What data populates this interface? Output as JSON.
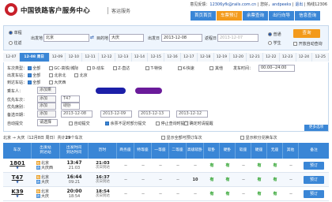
{
  "header": {
    "site_name": "中国铁路客户服务中心",
    "sub_name": "客运服务",
    "user_prefix": "意见反馈：",
    "email": "12306yfk@rails.com.cn",
    "sep1": "|",
    "welcome": "您好，",
    "username": "andpeeks",
    "sep2": "|",
    "logout": "退出",
    "sep3": "|",
    "phone": "热线12306"
  },
  "nav": [
    "首页首页",
    "车票预订",
    "余票查询",
    "出行向导",
    "信息查询"
  ],
  "search": {
    "oneway_label": "单程",
    "roundtrip_label": "往返",
    "from_label": "出发地",
    "from_value": "北京",
    "to_label": "目的地",
    "to_value": "大庆",
    "date_label": "出发日",
    "date_value": "2013-12-08",
    "return_label": "返程日",
    "return_value": "2013-12-07",
    "adult_label": "普通",
    "student_label": "学生",
    "query_button": "查询",
    "sort_label": "开放自动查询"
  },
  "dates": [
    "12-07",
    "12-08 周日",
    "12-09",
    "12-10",
    "12-11",
    "12-12",
    "12-13",
    "12-14",
    "12-15",
    "12-16",
    "12-17",
    "12-18",
    "12-19",
    "12-20",
    "12-21",
    "12-22",
    "12-23",
    "12-24",
    "12-25",
    "12-26"
  ],
  "filter": {
    "type_label": "车次类型：",
    "types": [
      "全部",
      "GC-高铁/城际",
      "D-动车",
      "Z-直达",
      "T-特快",
      "K-快速",
      "其他"
    ],
    "dep_label": "出发车站：",
    "dep_stations": [
      "全部",
      "北京北",
      "北京"
    ],
    "arr_label": "到达车站：",
    "arr_stations": [
      "全部",
      "大庆西"
    ],
    "time_label": "发车时间：",
    "time_value": "00:00--24:00",
    "passenger_label": "乘车人：",
    "passenger_add": "添加乘",
    "seat_label": "优先车次：",
    "seat_add": "添加",
    "train_tag": "T47",
    "seat_type_label": "优先席别：",
    "seat_type_add": "添加",
    "seat_type_value": "硬卧",
    "date_pref_label": "备选日期：",
    "date_pref_add": "添加",
    "pref_dates": [
      "2013-12-08",
      "2013-12-09",
      "2013-12-13",
      "2013-12-12"
    ],
    "submit_label": "自动提交",
    "submit_value": "请选择",
    "option1": "自动提交",
    "option2": "余票不足时部分提交",
    "option3": "停止查询时提醒",
    "option4": "确定时请提醒",
    "more": "更多选项"
  },
  "result": {
    "route": "北京 → 大庆（12月8日 周日）共计",
    "count": "29",
    "suffix": "个车次",
    "filter_note": "显示全部可预订车次",
    "sort_note": "显示积分兑换车次"
  },
  "table_header": [
    "车次",
    "出发站\n到达站",
    "出发时间\n到达时间",
    "历时",
    "商务座",
    "特等座",
    "一等座",
    "二等座",
    "高级软卧",
    "软卧",
    "硬卧",
    "软座",
    "硬座",
    "无座",
    "其他",
    "备注"
  ],
  "rows": [
    {
      "no": "1801",
      "from": "北京",
      "to": "大庆西",
      "dep": "13:47",
      "arr": "21:03",
      "dur": "21:03",
      "dur_note": "次日到达",
      "cells": [
        "--",
        "--",
        "--",
        "--",
        "--",
        "有",
        "有",
        "--",
        "有",
        "有",
        "--"
      ],
      "book": "预订"
    },
    {
      "no": "T47",
      "from": "北京",
      "to": "大庆",
      "dep": "16:44",
      "arr": "09:21",
      "dur": "16:37",
      "dur_note": "次日到达",
      "cells": [
        "--",
        "--",
        "--",
        "--",
        "10",
        "有",
        "有",
        "--",
        "有",
        "有",
        "--"
      ],
      "book": "预订"
    },
    {
      "no": "K39",
      "from": "北京",
      "to": "大庆",
      "dep": "20:00",
      "arr": "18:54",
      "dur": "18:54",
      "dur_note": "次日到达",
      "cells": [
        "--",
        "--",
        "--",
        "--",
        "--",
        "有",
        "有",
        "--",
        "有",
        "有",
        "--"
      ],
      "book": "预订"
    }
  ],
  "colors": {
    "accent": "#3a86d6",
    "orange": "#f39a1b",
    "brand_red": "#c8202a"
  }
}
